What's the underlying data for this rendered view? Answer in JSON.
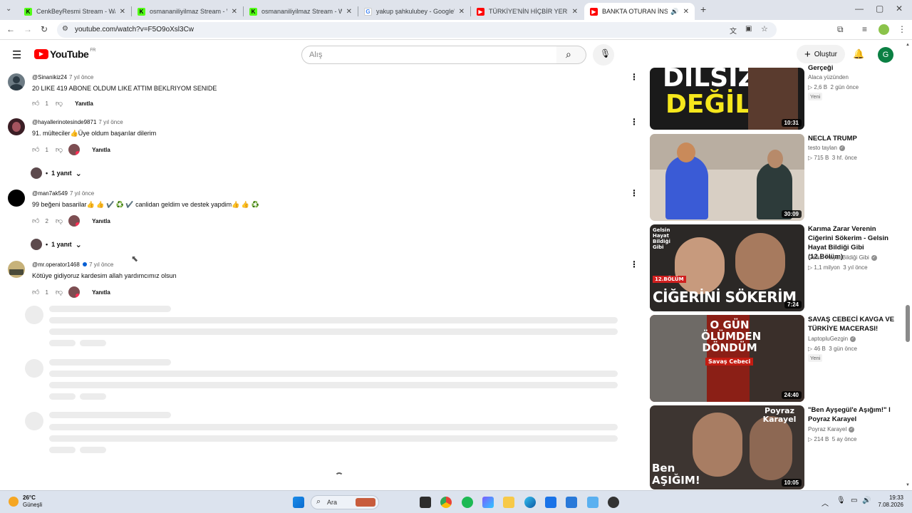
{
  "browser": {
    "tabs": [
      {
        "title": "CenkBeyResmi Stream - Watch",
        "favicon": "kick",
        "active": false
      },
      {
        "title": "osmananiliyilmaz Stream - Watc",
        "favicon": "kick",
        "active": false
      },
      {
        "title": "osmananiliyilmaz Stream - Watc",
        "favicon": "kick",
        "active": false
      },
      {
        "title": "yakup şahkulubey - Google'da A",
        "favicon": "google",
        "active": false
      },
      {
        "title": "TÜRKİYE'NİN HİÇBİR YERİNDE O",
        "favicon": "youtube",
        "active": false
      },
      {
        "title": "BANKTA OTURAN İNSANA",
        "favicon": "youtube",
        "active": true
      }
    ],
    "url": "youtube.com/watch?v=F5O9oXsl3Cw"
  },
  "youtube": {
    "logo_text": "YouTube",
    "region": "FR",
    "search_placeholder": "Alış",
    "create_label": "Oluştur",
    "avatar_letter": "G"
  },
  "comments": [
    {
      "author": "@Sinanikiz24",
      "time": "7 yıl önce",
      "text": "20 LIKE 419 ABONE OLDUM LIKE ATTIM BEKLRIYOM SENIDE",
      "likes": "1",
      "reply_label": "Yanıtla",
      "replies": ""
    },
    {
      "author": "@hayallerinotesinde9871",
      "time": "7 yıl önce",
      "text": "91. mülteciler👍Üye oldum başarılar dilerim",
      "likes": "1",
      "reply_label": "Yanıtla",
      "replies": "1 yanıt"
    },
    {
      "author": "@man7ak549",
      "time": "7 yıl önce",
      "text": "99 beğeni basarilar👍 👍 ✔️ ♻️ ✔️  canlidan geldim  ve destek yapdim👍 👍 ♻️",
      "likes": "2",
      "reply_label": "Yanıtla",
      "replies": "1 yanıt"
    },
    {
      "author": "@mr.operator1468",
      "time": "7 yıl önce",
      "text": "Kötüye gidiyoruz kardesim allah yardımcımız olsun",
      "likes": "1",
      "reply_label": "Yanıtla",
      "replies": ""
    }
  ],
  "sidebar": [
    {
      "title": "Gerçeği",
      "channel": "Alaca yüzünden",
      "views": "2,6 B",
      "age": "2 gün önce",
      "badge": "Yeni",
      "duration": "10:31",
      "thumb_text": "DİLSİZ DEĞİL",
      "verified": false
    },
    {
      "title": "NECLA TRUMP",
      "channel": "testo taylan",
      "views": "715 B",
      "age": "3 hf. önce",
      "badge": "",
      "duration": "30:09",
      "thumb_text": "",
      "verified": true
    },
    {
      "title": "Karıma Zarar Verenin Ciğerini Sökerim - Gelsin Hayat Bildiği Gibi (12.Bölüm)",
      "channel": "Gelsin Hayat Bildiği Gibi",
      "views": "1,1 milyon",
      "age": "3 yıl önce",
      "badge": "",
      "duration": "7:24",
      "thumb_text": "CİĞERİNİ SÖKERİM",
      "verified": true
    },
    {
      "title": "SAVAŞ CEBECİ KAVGA VE TÜRKİYE MACERASI!",
      "channel": "LaptopluGezgin",
      "views": "46 B",
      "age": "3 gün önce",
      "badge": "Yeni",
      "duration": "24:40",
      "thumb_text": "O GÜN ÖLÜMDEN DÖNDÜM",
      "verified": true
    },
    {
      "title": "\"Ben Ayşegül'e Aşığım!\" l Poyraz Karayel",
      "channel": "Poyraz Karayel",
      "views": "214 B",
      "age": "5 ay önce",
      "badge": "",
      "duration": "10:05",
      "thumb_text": "Ben AŞIĞIM!",
      "verified": true
    }
  ],
  "thumb_labels": {
    "gelsin": "Gelsin Hayat Bildiği Gibi",
    "episode": "12.BÖLÜM",
    "savas": "Savaş Cebeci",
    "poyraz": "Poyraz Karayel"
  },
  "taskbar": {
    "weather_temp": "26°C",
    "weather_desc": "Güneşli",
    "search_label": "Ara",
    "time": "19:33",
    "date": "7.08.2026"
  },
  "colors": {
    "youtube_red": "#ff0000",
    "kick_green": "#53fc18",
    "link_blue": "#065fd4"
  }
}
